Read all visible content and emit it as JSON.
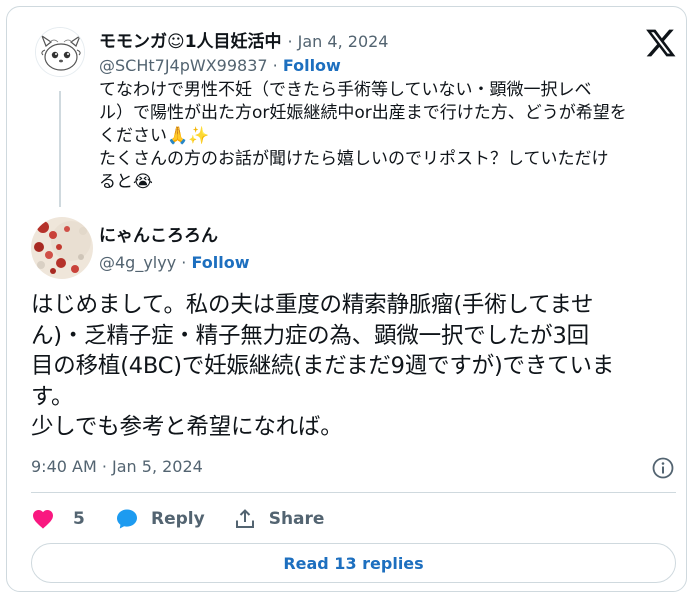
{
  "quoted_tweet": {
    "author_name": "モモンガ☺1人目妊活中",
    "date": "Jan 4, 2024",
    "handle": "@SCHt7J4pWX99837",
    "follow_label": "Follow",
    "text_lines": [
      "てなわけで男性不妊（できたら手術等していない・顕微一択レベ",
      "ル）で陽性が出た方or妊娠継続中or出産まで行けた方、どうが希望を",
      "ください🙏✨",
      "たくさんの方のお話が聞けたら嬉しいのでリポスト？していただけ",
      "ると😭"
    ]
  },
  "reply_tweet": {
    "author_name": "にゃんころろん",
    "handle": "@4g_ylyy",
    "follow_label": "Follow",
    "text_lines": [
      "はじめまして。私の夫は重度の精索静脈瘤(手術してませ",
      "ん)・乏精子症・精子無力症の為、顕微一択でしたが3回",
      "目の移植(4BC)で妊娠継続(まだまだ9週ですが)できていま",
      "す。",
      "少しでも参考と希望になれば。"
    ],
    "timestamp": "9:40 AM · Jan 5, 2024",
    "likes": "5",
    "reply_label": "Reply",
    "share_label": "Share",
    "read_replies_label": "Read 13 replies"
  },
  "colors": {
    "link": "#1d6fbf",
    "like_heart": "#f91880",
    "border": "#cfd9de",
    "muted_text": "#536471"
  },
  "icons": [
    "x-logo-icon",
    "info-icon",
    "heart-icon",
    "reply-bubble-icon",
    "share-icon"
  ]
}
